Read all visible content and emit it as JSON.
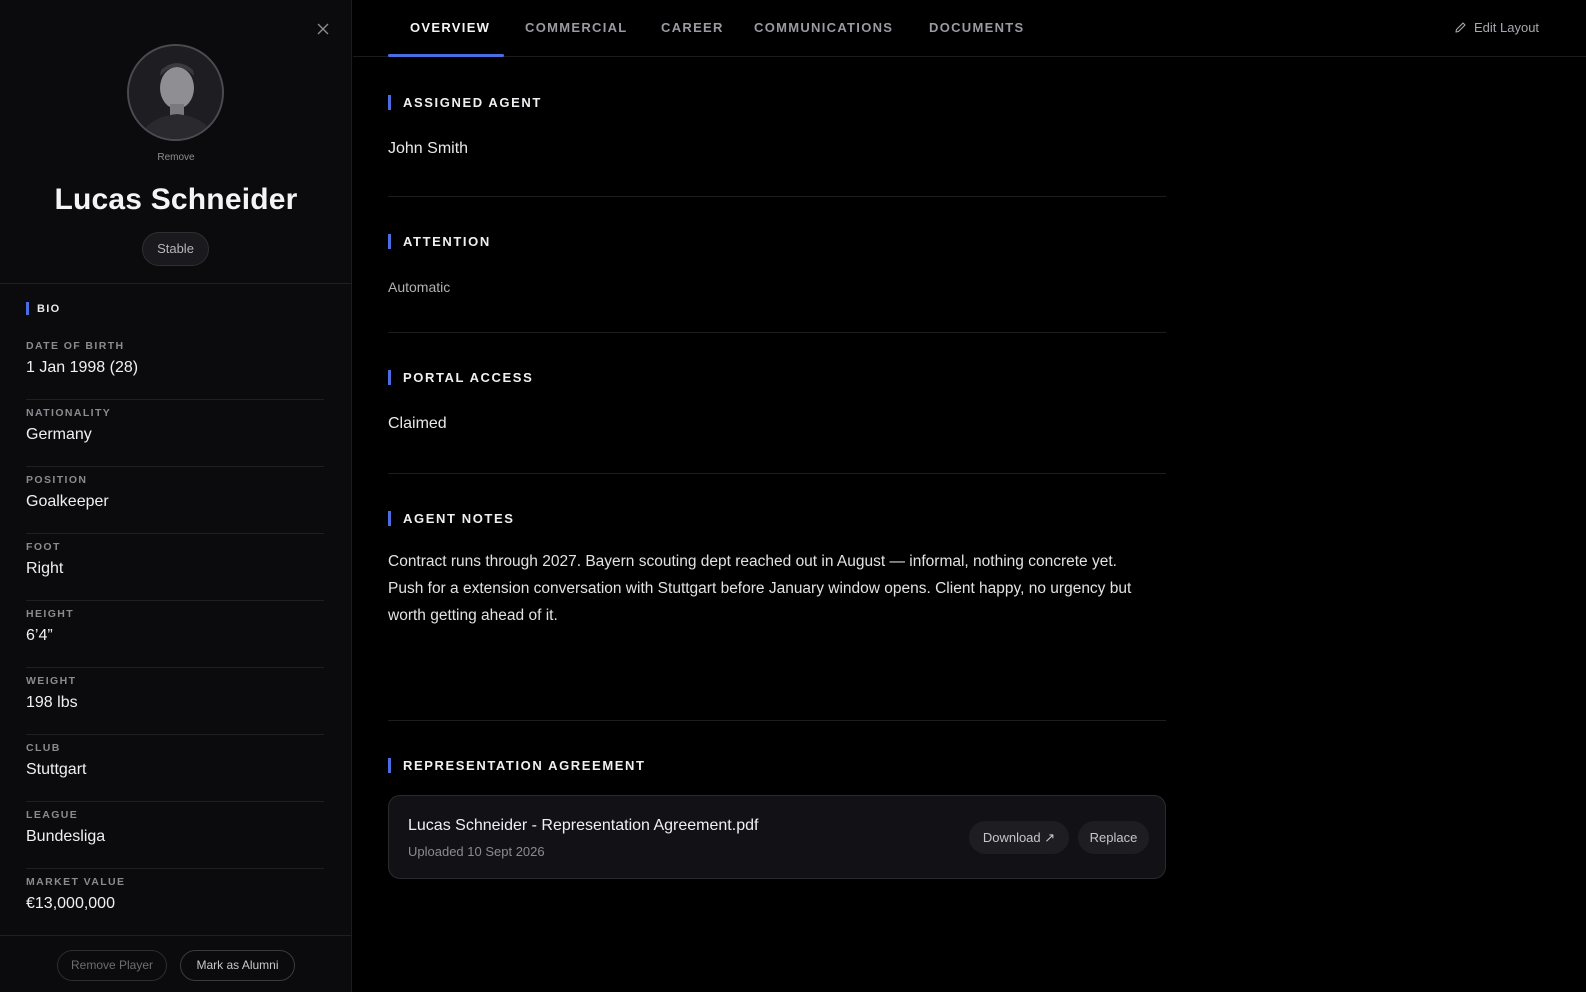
{
  "sidebar": {
    "remove_photo": "Remove",
    "player_name": "Lucas Schneider",
    "status": "Stable",
    "bio_title": "BIO",
    "bio": [
      {
        "label": "DATE OF BIRTH",
        "value": "1 Jan 1998 (28)"
      },
      {
        "label": "NATIONALITY",
        "value": "Germany"
      },
      {
        "label": "POSITION",
        "value": "Goalkeeper"
      },
      {
        "label": "FOOT",
        "value": "Right"
      },
      {
        "label": "HEIGHT",
        "value": "6’4”"
      },
      {
        "label": "WEIGHT",
        "value": "198 lbs"
      },
      {
        "label": "CLUB",
        "value": "Stuttgart"
      },
      {
        "label": "LEAGUE",
        "value": "Bundesliga"
      },
      {
        "label": "MARKET VALUE",
        "value": "€13,000,000"
      }
    ],
    "remove_player": "Remove Player",
    "mark_alumni": "Mark as Alumni"
  },
  "tabs": [
    {
      "label": "OVERVIEW"
    },
    {
      "label": "COMMERCIAL"
    },
    {
      "label": "CAREER"
    },
    {
      "label": "COMMUNICATIONS"
    },
    {
      "label": "DOCUMENTS"
    }
  ],
  "edit_layout": "Edit Layout",
  "sections": {
    "assigned_agent": {
      "title": "ASSIGNED AGENT",
      "value": "John Smith"
    },
    "attention": {
      "title": "ATTENTION",
      "value": "Automatic"
    },
    "portal_access": {
      "title": "PORTAL ACCESS",
      "value": "Claimed"
    },
    "agent_notes": {
      "title": "AGENT NOTES",
      "value": "Contract runs through 2027. Bayern scouting dept reached out in August — informal, nothing concrete yet. Push for a extension conversation with Stuttgart before January window opens. Client happy, no urgency but worth getting ahead of it."
    },
    "agreement": {
      "title": "REPRESENTATION AGREEMENT",
      "file_name": "Lucas Schneider - Representation Agreement.pdf",
      "uploaded": "Uploaded 10 Sept 2026",
      "download": "Download ↗",
      "replace": "Replace"
    }
  },
  "colors": {
    "accent": "#4a6ee0",
    "background": "#000000",
    "sidebar": "#0b0b0e"
  }
}
